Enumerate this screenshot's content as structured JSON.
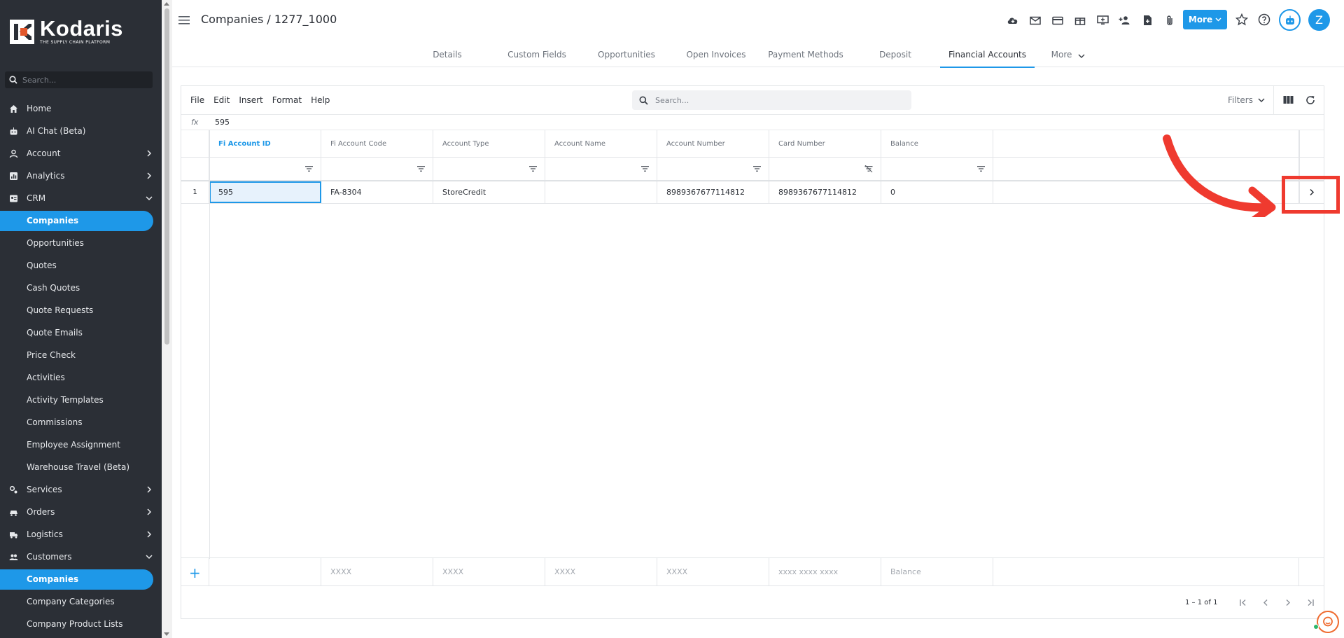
{
  "brand": {
    "name": "Kodaris",
    "tagline": "THE SUPPLY CHAIN PLATFORM",
    "accent": "#1e98e8",
    "sidebar_bg": "#2b2f36"
  },
  "sidebar": {
    "search_placeholder": "Search...",
    "items": [
      {
        "label": "Home",
        "icon": "home-icon"
      },
      {
        "label": "AI Chat (Beta)",
        "icon": "robot-icon"
      },
      {
        "label": "Account",
        "icon": "person-icon",
        "chevron": "right"
      },
      {
        "label": "Analytics",
        "icon": "chart-icon",
        "chevron": "right"
      },
      {
        "label": "CRM",
        "icon": "crm-icon",
        "chevron": "down"
      },
      {
        "label": "Companies",
        "sub": true,
        "active": true
      },
      {
        "label": "Opportunities",
        "sub": true
      },
      {
        "label": "Quotes",
        "sub": true
      },
      {
        "label": "Cash Quotes",
        "sub": true
      },
      {
        "label": "Quote Requests",
        "sub": true
      },
      {
        "label": "Quote Emails",
        "sub": true
      },
      {
        "label": "Price Check",
        "sub": true
      },
      {
        "label": "Activities",
        "sub": true
      },
      {
        "label": "Activity Templates",
        "sub": true
      },
      {
        "label": "Commissions",
        "sub": true
      },
      {
        "label": "Employee Assignment",
        "sub": true
      },
      {
        "label": "Warehouse Travel (Beta)",
        "sub": true
      },
      {
        "label": "Services",
        "icon": "services-icon",
        "chevron": "right"
      },
      {
        "label": "Orders",
        "icon": "orders-icon",
        "chevron": "right"
      },
      {
        "label": "Logistics",
        "icon": "truck-icon",
        "chevron": "right"
      },
      {
        "label": "Customers",
        "icon": "customers-icon",
        "chevron": "down"
      },
      {
        "label": "Companies",
        "sub": true,
        "active": true
      },
      {
        "label": "Company Categories",
        "sub": true
      },
      {
        "label": "Company Product Lists",
        "sub": true
      }
    ]
  },
  "header": {
    "title": "Companies / 1277_1000",
    "more_label": "More",
    "avatar_initial": "Z",
    "icons": [
      "cloud-icon",
      "mail-icon",
      "card-icon",
      "gift-icon",
      "screen-icon",
      "add-person-icon",
      "document-icon",
      "paperclip-icon"
    ]
  },
  "tabs": [
    {
      "label": "Details"
    },
    {
      "label": "Custom Fields"
    },
    {
      "label": "Opportunities"
    },
    {
      "label": "Open Invoices"
    },
    {
      "label": "Payment Methods"
    },
    {
      "label": "Deposit"
    },
    {
      "label": "Financial Accounts",
      "active": true
    },
    {
      "label": "More",
      "dropdown": true
    }
  ],
  "grid": {
    "menu": [
      "File",
      "Edit",
      "Insert",
      "Format",
      "Help"
    ],
    "search_placeholder": "Search...",
    "filters_label": "Filters",
    "fx_label": "fx",
    "fx_value": "595",
    "columns": [
      "Fi Account ID",
      "Fi Account Code",
      "Account Type",
      "Account Name",
      "Account Number",
      "Card Number",
      "Balance"
    ],
    "rows": [
      {
        "num": "1",
        "cells": [
          "595",
          "FA-8304",
          "StoreCredit",
          "",
          "8989367677114812",
          "8989367677114812",
          "0"
        ]
      }
    ],
    "new_row_placeholders": [
      "",
      "XXXX",
      "XXXX",
      "XXXX",
      "XXXX",
      "xxxx xxxx xxxx",
      "Balance"
    ],
    "pager_text": "1 – 1 of 1"
  },
  "annotation": {
    "color": "#ef3a2f"
  }
}
